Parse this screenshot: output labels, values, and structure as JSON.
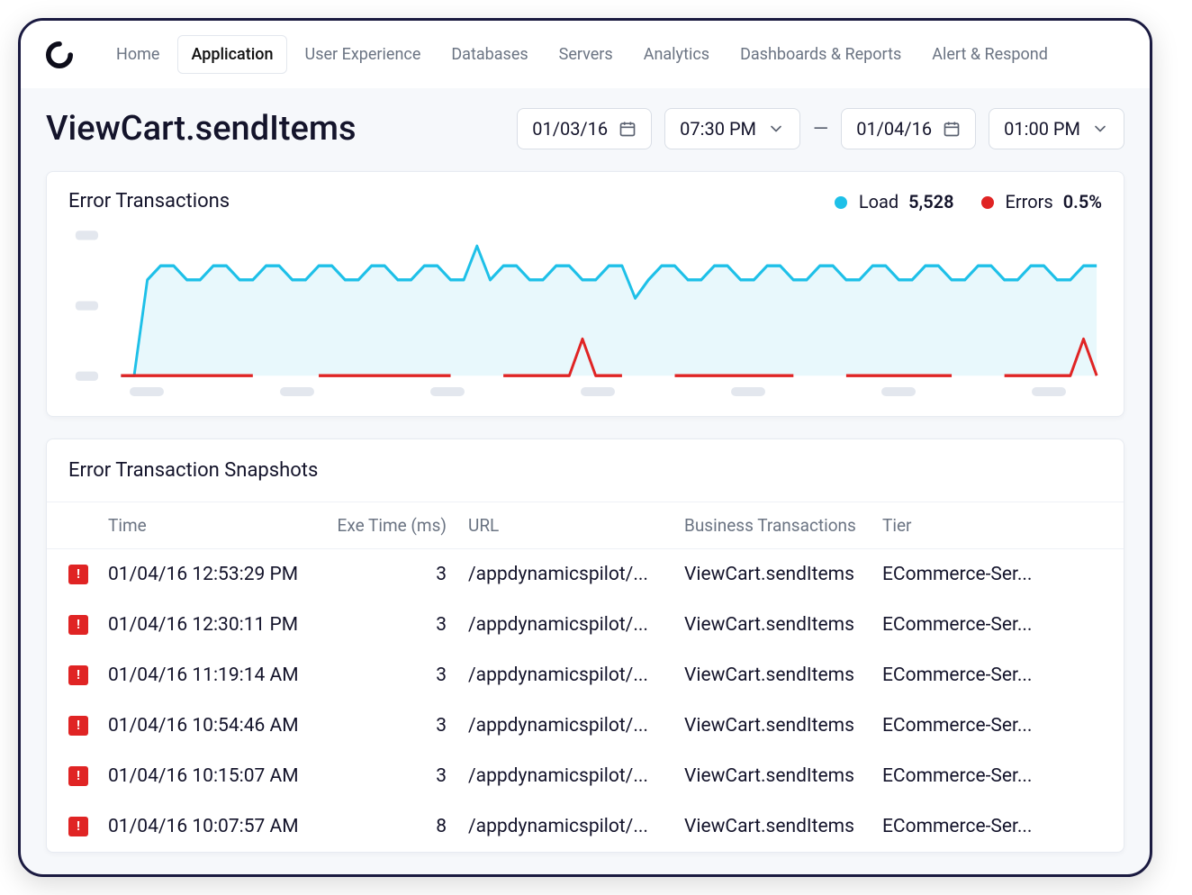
{
  "nav": {
    "items": [
      "Home",
      "Application",
      "User Experience",
      "Databases",
      "Servers",
      "Analytics",
      "Dashboards & Reports",
      "Alert & Respond"
    ],
    "active_index": 1
  },
  "header": {
    "title": "ViewCart.sendItems",
    "range": {
      "start_date": "01/03/16",
      "start_time": "07:30 PM",
      "end_date": "01/04/16",
      "end_time": "01:00 PM"
    }
  },
  "chart_card": {
    "title": "Error Transactions",
    "legend": {
      "load_label": "Load",
      "load_value": "5,528",
      "errors_label": "Errors",
      "errors_value": "0.5%"
    }
  },
  "chart_data": {
    "type": "line",
    "x": [
      0,
      1,
      2,
      3,
      4,
      5,
      6,
      7,
      8,
      9,
      10,
      11,
      12,
      13,
      14,
      15,
      16,
      17,
      18,
      19,
      20,
      21,
      22,
      23,
      24,
      25,
      26,
      27,
      28,
      29,
      30,
      31,
      32,
      33,
      34,
      35,
      36,
      37,
      38,
      39,
      40,
      41,
      42,
      43,
      44,
      45,
      46,
      47,
      48,
      49,
      50,
      51,
      52,
      53,
      54,
      55,
      56,
      57,
      58,
      59,
      60,
      61,
      62,
      63,
      64,
      65,
      66,
      67,
      68,
      69,
      70,
      71,
      72,
      73,
      74
    ],
    "y_ticks": [
      0,
      50,
      100
    ],
    "series": [
      {
        "name": "Load",
        "color": "#1ec0e8",
        "values": [
          0,
          0,
          68,
          78,
          78,
          68,
          68,
          78,
          78,
          68,
          68,
          78,
          78,
          68,
          68,
          78,
          78,
          68,
          68,
          78,
          78,
          68,
          68,
          78,
          78,
          68,
          68,
          92,
          68,
          78,
          78,
          68,
          68,
          78,
          78,
          68,
          68,
          78,
          78,
          55,
          68,
          78,
          78,
          68,
          68,
          78,
          78,
          68,
          68,
          78,
          78,
          68,
          68,
          78,
          78,
          68,
          68,
          78,
          78,
          68,
          68,
          78,
          78,
          68,
          68,
          78,
          78,
          68,
          68,
          78,
          78,
          68,
          68,
          78,
          78
        ]
      },
      {
        "name": "Errors",
        "color": "#e02424",
        "values": [
          0,
          0,
          0,
          0,
          0,
          0,
          0,
          0,
          0,
          0,
          0,
          null,
          null,
          null,
          null,
          0,
          0,
          0,
          0,
          0,
          0,
          0,
          0,
          0,
          0,
          0,
          null,
          null,
          null,
          0,
          0,
          0,
          0,
          0,
          0,
          26,
          0,
          0,
          0,
          null,
          null,
          null,
          0,
          0,
          0,
          0,
          0,
          0,
          0,
          0,
          0,
          0,
          null,
          null,
          null,
          0,
          0,
          0,
          0,
          0,
          0,
          0,
          0,
          0,
          null,
          null,
          null,
          0,
          0,
          0,
          0,
          0,
          0,
          26,
          0
        ]
      }
    ],
    "ylim": [
      0,
      100
    ]
  },
  "snapshots": {
    "title": "Error Transaction Snapshots",
    "columns": [
      "Time",
      "Exe Time (ms)",
      "URL",
      "Business Transactions",
      "Tier"
    ],
    "rows": [
      {
        "time": "01/04/16 12:53:29 PM",
        "exe": "3",
        "url": "/appdynamicspilot/...",
        "bt": "ViewCart.sendItems",
        "tier": "ECommerce-Ser..."
      },
      {
        "time": "01/04/16 12:30:11 PM",
        "exe": "3",
        "url": "/appdynamicspilot/...",
        "bt": "ViewCart.sendItems",
        "tier": "ECommerce-Ser..."
      },
      {
        "time": "01/04/16 11:19:14 AM",
        "exe": "3",
        "url": "/appdynamicspilot/...",
        "bt": "ViewCart.sendItems",
        "tier": "ECommerce-Ser..."
      },
      {
        "time": "01/04/16 10:54:46 AM",
        "exe": "3",
        "url": "/appdynamicspilot/...",
        "bt": "ViewCart.sendItems",
        "tier": "ECommerce-Ser..."
      },
      {
        "time": "01/04/16 10:15:07 AM",
        "exe": "3",
        "url": "/appdynamicspilot/...",
        "bt": "ViewCart.sendItems",
        "tier": "ECommerce-Ser..."
      },
      {
        "time": "01/04/16 10:07:57 AM",
        "exe": "8",
        "url": "/appdynamicspilot/...",
        "bt": "ViewCart.sendItems",
        "tier": "ECommerce-Ser..."
      }
    ]
  }
}
